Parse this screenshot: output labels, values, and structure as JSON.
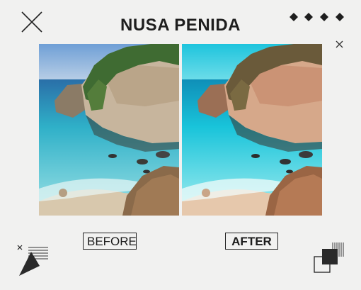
{
  "title": "NUSA PENIDA",
  "labels": {
    "before": "BEFORE",
    "after": "AFTER"
  },
  "photos": {
    "before": {
      "sky": "#7fa8d8",
      "sea": "#3ec4d4",
      "rock": "#c8b7a2"
    },
    "after": {
      "sky": "#2fc9dc",
      "sea": "#19c8db",
      "rock": "#d4a588"
    }
  },
  "decorations": {
    "top_left": "x-cross-icon",
    "top_right": "diamond-row-icon",
    "close": "close-icon",
    "bottom_left": "triangle-stripes-icon",
    "bottom_right": "overlapping-squares-icon"
  }
}
